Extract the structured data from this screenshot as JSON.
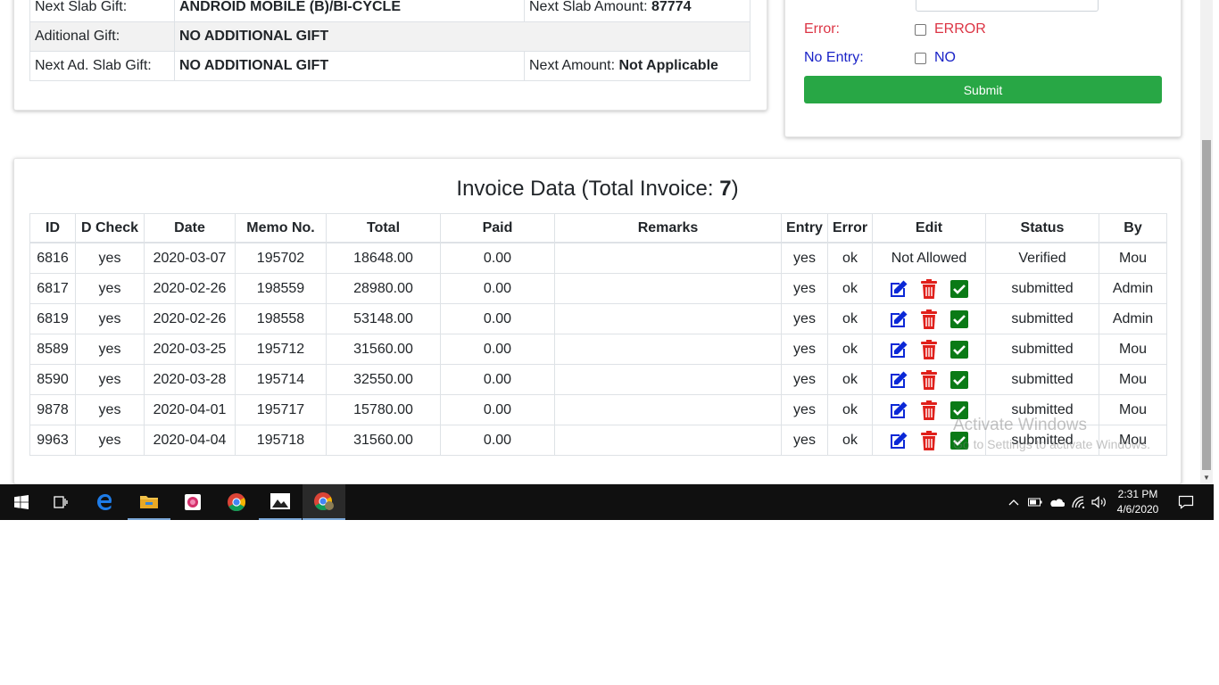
{
  "gift_panel": {
    "rows": [
      {
        "label": "Next Slab Gift:",
        "value": "ANDROID MOBILE (B)/BI-CYCLE",
        "extra_label": "Next Slab Amount:",
        "extra_value": "87774"
      },
      {
        "label": "Aditional Gift:",
        "value": "NO ADDITIONAL GIFT"
      },
      {
        "label": "Next Ad. Slab Gift:",
        "value": "NO ADDITIONAL GIFT",
        "extra_label": "Next Amount:",
        "extra_value": "Not Applicable"
      }
    ]
  },
  "entry_form": {
    "error_label": "Error:",
    "error_checkbox_label": "ERROR",
    "noentry_label": "No Entry:",
    "noentry_checkbox_label": "NO",
    "submit_label": "Submit"
  },
  "invoice": {
    "title_prefix": "Invoice Data (Total Invoice: ",
    "total_count": "7",
    "title_suffix": ")",
    "columns": [
      "ID",
      "D Check",
      "Date",
      "Memo No.",
      "Total",
      "Paid",
      "Remarks",
      "Entry",
      "Error",
      "Edit",
      "Status",
      "By"
    ],
    "rows": [
      {
        "id": "6816",
        "dcheck": "yes",
        "date": "2020-03-07",
        "memo": "195702",
        "total": "18648.00",
        "paid": "0.00",
        "remarks": "",
        "entry": "yes",
        "error": "ok",
        "edit_text": "Not Allowed",
        "status": "Verified",
        "by": "Mou"
      },
      {
        "id": "6817",
        "dcheck": "yes",
        "date": "2020-02-26",
        "memo": "198559",
        "total": "28980.00",
        "paid": "0.00",
        "remarks": "",
        "entry": "yes",
        "error": "ok",
        "edit_text": "",
        "status": "submitted",
        "by": "Admin"
      },
      {
        "id": "6819",
        "dcheck": "yes",
        "date": "2020-02-26",
        "memo": "198558",
        "total": "53148.00",
        "paid": "0.00",
        "remarks": "",
        "entry": "yes",
        "error": "ok",
        "edit_text": "",
        "status": "submitted",
        "by": "Admin"
      },
      {
        "id": "8589",
        "dcheck": "yes",
        "date": "2020-03-25",
        "memo": "195712",
        "total": "31560.00",
        "paid": "0.00",
        "remarks": "",
        "entry": "yes",
        "error": "ok",
        "edit_text": "",
        "status": "submitted",
        "by": "Mou"
      },
      {
        "id": "8590",
        "dcheck": "yes",
        "date": "2020-03-28",
        "memo": "195714",
        "total": "32550.00",
        "paid": "0.00",
        "remarks": "",
        "entry": "yes",
        "error": "ok",
        "edit_text": "",
        "status": "submitted",
        "by": "Mou"
      },
      {
        "id": "9878",
        "dcheck": "yes",
        "date": "2020-04-01",
        "memo": "195717",
        "total": "15780.00",
        "paid": "0.00",
        "remarks": "",
        "entry": "yes",
        "error": "ok",
        "edit_text": "",
        "status": "submitted",
        "by": "Mou"
      },
      {
        "id": "9963",
        "dcheck": "yes",
        "date": "2020-04-04",
        "memo": "195718",
        "total": "31560.00",
        "paid": "0.00",
        "remarks": "",
        "entry": "yes",
        "error": "ok",
        "edit_text": "",
        "status": "submitted",
        "by": "Mou"
      }
    ],
    "edit_icons": [
      "edit-icon",
      "delete-icon",
      "verify-check-icon"
    ],
    "colors": {
      "edit": "#0b28d6",
      "delete": "#e0201b",
      "verify": "#0a7a16"
    }
  },
  "watermark": {
    "line1": "Activate Windows",
    "line2": "Go to Settings to activate Windows."
  },
  "taskbar": {
    "apps": [
      "windows-start-icon",
      "task-view-icon",
      "edge-icon",
      "file-explorer-icon",
      "photos-app-icon",
      "chrome-icon",
      "photos-icon",
      "chrome-profile-icon"
    ],
    "tray_icons": [
      "show-hidden-icons-chevron",
      "battery-icon",
      "onedrive-icon",
      "wifi-icon",
      "volume-icon",
      "action-center-icon"
    ],
    "time": "2:31 PM",
    "date": "4/6/2020"
  },
  "colors": {
    "submit": "#28a745",
    "error_label": "#dc3545",
    "noentry_label": "#1a23c7",
    "taskbar": "#101010"
  }
}
